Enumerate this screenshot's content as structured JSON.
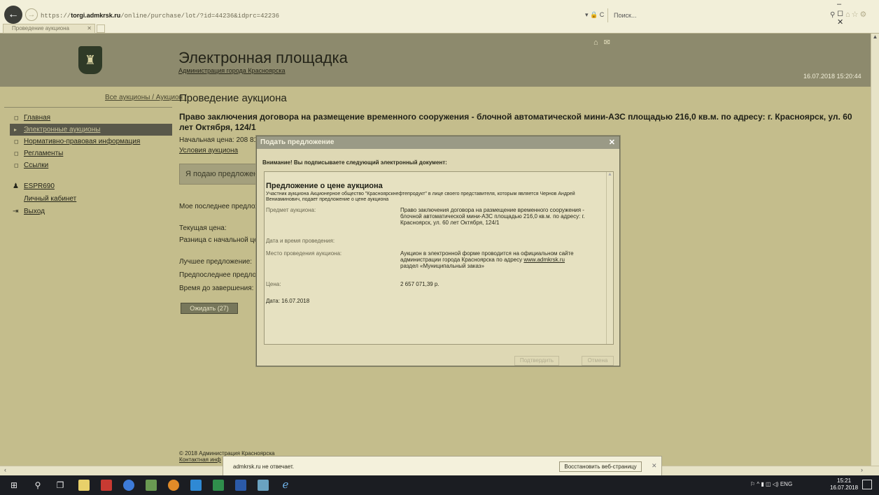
{
  "browser": {
    "url_prefix": "https://",
    "url_domain": "torgi.admkrsk.ru",
    "url_path": "/online/purchase/lot/?id=44236&idprc=42236",
    "addr_icons": "▾ 🔒 C",
    "search_placeholder": "Поиск...",
    "tab_title": "Проведение аукциона",
    "win_controls": "– ◻ ✕"
  },
  "header": {
    "title": "Электронная площадка",
    "subtitle": "Администрация города Красноярска",
    "datetime": "16.07.2018 15:20:44"
  },
  "breadcrumb": "Все аукционы / Аукцион /",
  "page_title": "Проведение аукциона",
  "sidebar": {
    "items": [
      {
        "label": "Главная"
      },
      {
        "label": "Электронные аукционы"
      },
      {
        "label": "Нормативно-правовая информация"
      },
      {
        "label": "Регламенты"
      },
      {
        "label": "Ссылки"
      }
    ],
    "user": {
      "name": "ESPR690",
      "cabinet": "Личный кабинет",
      "logout": "Выход"
    }
  },
  "lot": {
    "title": "Право заключения договора на размещение временного сооружения - блочной автоматической мини-АЗС площадью 216,0 кв.м. по адресу: г. Красноярск, ул. 60 лет Октября, 124/1",
    "start_price": "Начальная цена: 208 812,",
    "conditions_link": "Условия аукциона",
    "bid_bar": "Я подаю предложение",
    "my_last_offer": "Мое последнее предложе",
    "current_price": "Текущая цена:",
    "diff": "Разница с начальной цен",
    "best_offer": "Лучшее предложение:",
    "prev_offer": "Предпоследнее предложе",
    "time_left": "Время до завершения:",
    "wait_button": "Ожидать (27)"
  },
  "footer": {
    "copyright": "© 2018 Администрация Красноярска",
    "contacts": "Контактная инф"
  },
  "modal": {
    "title": "Подать предложение",
    "warning": "Внимание! Вы подписываете следующий электронный документ:",
    "doc_heading": "Предложение о цене аукциона",
    "doc_intro": "Участник аукциона Акционерное общество \"Красноярскнефтепродукт\" в лице своего представителя, которым является Чернов Андрей Вениаминович, подает предложение о цене аукциона",
    "subject_label": "Предмет аукциона:",
    "subject_value": "Право заключения договора на размещение временного сооружения - блочной автоматической мини-АЗС площадью 216,0 кв.м. по адресу: г. Красноярск, ул. 60 лет Октября, 124/1",
    "datetime_label": "Дата и время проведения:",
    "place_label": "Место проведения аукциона:",
    "place_value_1": "Аукцион в электронной форме проводится на официальном сайте администрации города Красноярска по адресу ",
    "place_link": "www.admkrsk.ru",
    "place_value_2": "раздел «Муниципальный заказ»",
    "price_label": "Цена:",
    "price_value": "2 657 071,39 р.",
    "date_line": "Дата: 16.07.2018",
    "sign_button": "Подтвердить",
    "cancel_button": "Отмена"
  },
  "notification": {
    "text": "admkrsk.ru не отвечает.",
    "button": "Восстановить веб-страницу"
  },
  "taskbar": {
    "tray": "ENG",
    "time": "15:21",
    "date": "16.07.2018"
  }
}
